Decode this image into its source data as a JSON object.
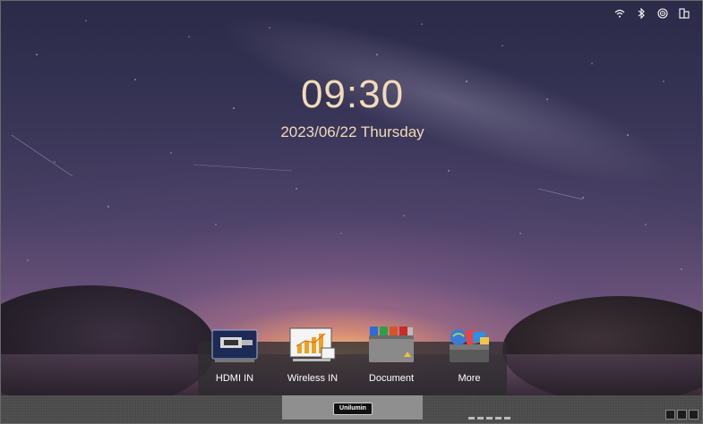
{
  "status_bar": {
    "icons": [
      "wifi-icon",
      "bluetooth-icon",
      "hotspot-icon",
      "screen-share-icon"
    ]
  },
  "clock": {
    "time": "09:30",
    "date": "2023/06/22 Thursday"
  },
  "dock": {
    "items": [
      {
        "label": "HDMI IN",
        "icon": "hdmi-icon"
      },
      {
        "label": "Wireless IN",
        "icon": "wireless-in-icon"
      },
      {
        "label": "Document",
        "icon": "document-folder-icon"
      },
      {
        "label": "More",
        "icon": "more-apps-icon"
      }
    ]
  },
  "taskbar": {
    "brand": "Unilumin"
  },
  "colors": {
    "clock_text": "#f1dbb8",
    "dock_background": "#2d2c30",
    "taskbar_background": "#4a4a4a"
  }
}
